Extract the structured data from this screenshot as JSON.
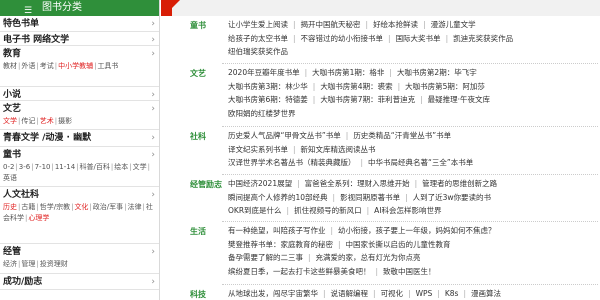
{
  "sidebar": {
    "header": "图书分类",
    "header_icon": "list-icon",
    "categories": [
      {
        "title": "特色书单",
        "links": []
      },
      {
        "title": "电子书 网络文学",
        "links": []
      },
      {
        "title": "教育",
        "links": [
          {
            "t": "教材"
          },
          {
            "t": "外语"
          },
          {
            "t": "考试"
          },
          {
            "t": "中小学教辅",
            "red": true
          },
          {
            "t": "工具书"
          }
        ]
      },
      {
        "title": "小说",
        "links": []
      },
      {
        "title": "文艺",
        "links": [
          {
            "t": "文学",
            "red": true
          },
          {
            "t": "传记"
          },
          {
            "t": "艺术",
            "red": true
          },
          {
            "t": "摄影"
          }
        ]
      },
      {
        "title": "青春文学 /动漫 · 幽默",
        "links": []
      },
      {
        "title": "童书",
        "links": [
          {
            "t": "0-2"
          },
          {
            "t": "3-6"
          },
          {
            "t": "7-10"
          },
          {
            "t": "11-14"
          },
          {
            "t": "科普/百科"
          },
          {
            "t": "绘本"
          },
          {
            "t": "文学"
          },
          {
            "t": "英语"
          }
        ]
      },
      {
        "title": "人文社科",
        "links": [
          {
            "t": "历史",
            "red": true
          },
          {
            "t": "古籍"
          },
          {
            "t": "哲学/宗教"
          },
          {
            "t": "文化",
            "red": true
          },
          {
            "t": "政治/军事"
          },
          {
            "t": "法律"
          },
          {
            "t": "社会科学"
          },
          {
            "t": "心理学",
            "red": true
          }
        ]
      },
      {
        "title": "经管",
        "links": [
          {
            "t": "经济"
          },
          {
            "t": "管理"
          },
          {
            "t": "投资理财"
          }
        ]
      },
      {
        "title": "成功/励志",
        "links": []
      }
    ]
  },
  "main": {
    "sections": [
      {
        "label": "童书",
        "rows": [
          [
            "让小学生爱上阅读",
            "揭开中国航天秘密",
            "好绘本抢鲜读",
            "漫游儿童文学"
          ],
          [
            "给孩子的太空书单",
            "不容错过的幼小衔接书单",
            "国际大奖书单",
            "凯迪克奖获奖作品"
          ],
          [
            "纽伯瑞奖获奖作品"
          ]
        ]
      },
      {
        "label": "文艺",
        "rows": [
          [
            "2020年豆瓣年度书单",
            "大咖书房第1期：格非",
            "大咖书房第2期：毕飞宇"
          ],
          [
            "大咖书房第3期：林少华",
            "大咖书房第4期：裘索",
            "大咖书房第5期：阿加莎"
          ],
          [
            "大咖书房第6期：特德姜",
            "大咖书房第7期：菲利普迪克",
            "最疑推理·午夜文库"
          ],
          [
            "欧阳娟的红楼梦世界"
          ]
        ]
      },
      {
        "label": "社科",
        "rows": [
          [
            "历史爱人气品牌“甲骨文丛书”书单",
            "历史类精品“汗青堂丛书”书单"
          ],
          [
            "译文纪实系列书单",
            "新知文库精选阅读丛书"
          ],
          [
            "汉译世界学术名著丛书（精装典藏版）",
            "中华书局经典名著“三全”本书单"
          ]
        ]
      },
      {
        "label": "经管励志",
        "rows": [
          [
            "中国经济2021展望",
            "富爸爸全系列：理财入思维开始",
            "管理者的思维创新之路"
          ],
          [
            "瞬间提高个人修养的10部经典",
            "影视同期原著书单",
            "人到了近3w你要读的书"
          ],
          [
            "OKR到底是什么",
            "抓住视频号的新风口",
            "AI科会怎样影响世界"
          ]
        ]
      },
      {
        "label": "生活",
        "rows": [
          [
            "有一种绝望，叫陪孩子写作业",
            "幼小衔接，孩子要上一年级，妈妈如何不焦虑？"
          ],
          [
            "樊登推荐书单：家庭教育的秘密",
            "中国家长撕以启齿的儿童性教育"
          ],
          [
            "备孕需要了解的二三事",
            "充满爱的家，总有灯光为你点亮"
          ],
          [
            "缤纷夏日季，一起去打卡这些鲜暴美食吧！",
            "致敬中国医生！"
          ]
        ]
      },
      {
        "label": "科技",
        "rows": [
          [
            "从地球出发，闯尽宇宙繁华",
            "说语解编程",
            "可视化",
            "WPS",
            "K8s",
            "漫画算法"
          ]
        ]
      }
    ]
  }
}
